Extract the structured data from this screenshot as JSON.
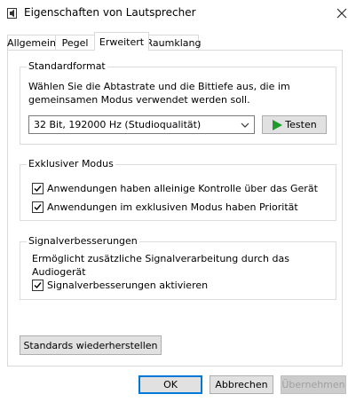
{
  "window": {
    "title": "Eigenschaften von Lautsprecher"
  },
  "tabs": [
    {
      "label": "Allgemein"
    },
    {
      "label": "Pegel"
    },
    {
      "label": "Erweitert"
    },
    {
      "label": "Raumklang"
    }
  ],
  "standardformat": {
    "title": "Standardformat",
    "description_line1": "Wählen Sie die Abtastrate und die Bittiefe aus, die im",
    "description_line2": "gemeinsamen Modus verwendet werden soll.",
    "selected_format": "32 Bit, 192000 Hz (Studioqualität)",
    "test_label": "Testen"
  },
  "exklusiv": {
    "title": "Exklusiver Modus",
    "option1": "Anwendungen haben alleinige Kontrolle über das Gerät",
    "option2": "Anwendungen im exklusiven Modus haben Priorität",
    "option1_checked": true,
    "option2_checked": true
  },
  "signal": {
    "title": "Signalverbesserungen",
    "description": "Ermöglicht zusätzliche Signalverarbeitung durch das Audiogerät",
    "option": "Signalverbesserungen aktivieren",
    "option_checked": true
  },
  "restore_label": "Standards wiederherstellen",
  "footer": {
    "ok_label": "OK",
    "cancel_label": "Abbrechen",
    "apply_label": "Übernehmen"
  },
  "colors": {
    "accent": "#0078d7",
    "play_green": "#1e9c2b"
  }
}
